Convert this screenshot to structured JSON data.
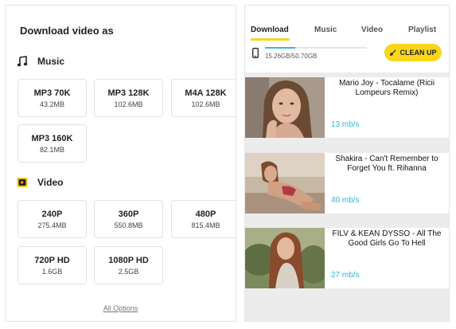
{
  "left_panel": {
    "title": "Download video as",
    "music_section": {
      "label": "Music",
      "icon": "music-note-icon"
    },
    "music_options": [
      {
        "quality": "MP3 70K",
        "size": "43.2MB"
      },
      {
        "quality": "MP3 128K",
        "size": "102.6MB"
      },
      {
        "quality": "M4A 128K",
        "size": "102.6MB"
      },
      {
        "quality": "MP3 160K",
        "size": "82.1MB"
      }
    ],
    "video_section": {
      "label": "Video",
      "icon": "play-icon"
    },
    "video_options": [
      {
        "quality": "240P",
        "size": "275.4MB"
      },
      {
        "quality": "360P",
        "size": "550.8MB"
      },
      {
        "quality": "480P",
        "size": "815.4MB"
      },
      {
        "quality": "720P HD",
        "size": "1.6GB"
      },
      {
        "quality": "1080P HD",
        "size": "2.5GB"
      }
    ],
    "all_options_link": "All Options"
  },
  "right_panel": {
    "tabs": [
      {
        "label": "Download",
        "active": true
      },
      {
        "label": "Music",
        "active": false
      },
      {
        "label": "Video",
        "active": false
      },
      {
        "label": "Playlist",
        "active": false
      }
    ],
    "storage": {
      "text": "15.26GB/50.70GB",
      "used_fraction": 0.3
    },
    "cleanup_button": {
      "label": "CLEAN UP",
      "icon": "broom-icon"
    },
    "videos": [
      {
        "title": "Mario Joy - Tocalame (Ricii Lompeurs Remix)",
        "speed": "13 mb/s"
      },
      {
        "title": "Shakira - Can't Remember to Forget You ft. Rihanna",
        "speed": "40 mb/s"
      },
      {
        "title": "FILV & KEAN DYSSO - All The Good Girls Go To Hell",
        "speed": "27 mb/s"
      }
    ]
  },
  "colors": {
    "accent_yellow": "#f8d61c",
    "speed_blue": "#2cb8d6",
    "storage_bar": "#39b8d8"
  }
}
